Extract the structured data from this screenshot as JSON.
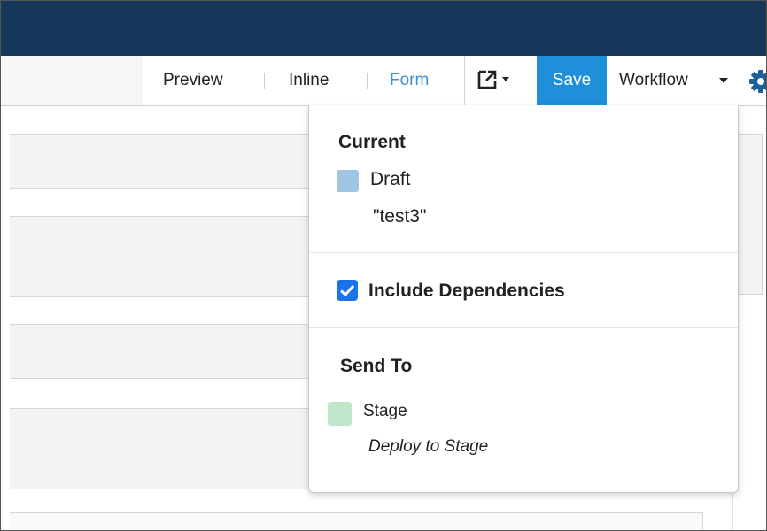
{
  "toolbar": {
    "view_modes": [
      "Preview",
      "Inline",
      "Form"
    ],
    "save_label": "Save",
    "workflow_label": "Workflow"
  },
  "workflow_menu": {
    "current": {
      "title": "Current",
      "state": "Draft",
      "state_color": "#9fc5e3",
      "comment": "\"test3\""
    },
    "include_dependencies": {
      "label": "Include Dependencies",
      "checked": true
    },
    "send_to": {
      "title": "Send To",
      "target": "Stage",
      "target_color": "#bfe6c9",
      "action": "Deploy to Stage"
    }
  },
  "colors": {
    "top_bar": "#14375a",
    "save_button": "#1e8fd8",
    "form_link": "#3a8fd6",
    "checkbox": "#1a73e8"
  }
}
